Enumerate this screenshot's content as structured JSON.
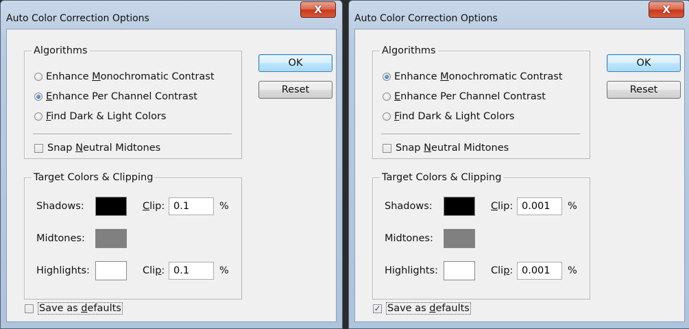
{
  "dialogs": [
    {
      "title": "Auto Color Correction Options",
      "algorithms_legend": "Algorithms",
      "algorithms": [
        {
          "pre": "Enhance ",
          "u": "M",
          "post": "onochromatic Contrast",
          "selected": false
        },
        {
          "pre": "",
          "u": "E",
          "post": "nhance Per Channel Contrast",
          "selected": true
        },
        {
          "pre": "",
          "u": "F",
          "post": "ind Dark & Light Colors",
          "selected": false
        }
      ],
      "snap": {
        "pre": "Snap ",
        "u": "N",
        "post": "eutral Midtones",
        "checked": false
      },
      "ok_label": "OK",
      "reset_label": "Reset",
      "target_legend": "Target Colors & Clipping",
      "shadows_label": "Shadows:",
      "midtones_label": "Midtones:",
      "highlights_label": "Highlights:",
      "clip1": {
        "u": "C",
        "post": "lip:"
      },
      "clip2": {
        "pre": "Cli",
        "u": "p",
        "post": ":"
      },
      "shadows_clip": "0.1",
      "highlights_clip": "0.1",
      "percent": "%",
      "shadows_color": "#000000",
      "midtones_color": "#808080",
      "highlights_color": "#ffffff",
      "save_defaults": {
        "pre": "Save as ",
        "u": "d",
        "post": "efaults",
        "checked": false
      }
    },
    {
      "title": "Auto Color Correction Options",
      "algorithms_legend": "Algorithms",
      "algorithms": [
        {
          "pre": "Enhance ",
          "u": "M",
          "post": "onochromatic Contrast",
          "selected": true
        },
        {
          "pre": "",
          "u": "E",
          "post": "nhance Per Channel Contrast",
          "selected": false
        },
        {
          "pre": "",
          "u": "F",
          "post": "ind Dark & Light Colors",
          "selected": false
        }
      ],
      "snap": {
        "pre": "Snap ",
        "u": "N",
        "post": "eutral Midtones",
        "checked": false
      },
      "ok_label": "OK",
      "reset_label": "Reset",
      "target_legend": "Target Colors & Clipping",
      "shadows_label": "Shadows:",
      "midtones_label": "Midtones:",
      "highlights_label": "Highlights:",
      "clip1": {
        "u": "C",
        "post": "lip:"
      },
      "clip2": {
        "pre": "Cli",
        "u": "p",
        "post": ":"
      },
      "shadows_clip": "0.001",
      "highlights_clip": "0.001",
      "percent": "%",
      "shadows_color": "#000000",
      "midtones_color": "#808080",
      "highlights_color": "#ffffff",
      "save_defaults": {
        "pre": "Save as ",
        "u": "d",
        "post": "efaults",
        "checked": true
      }
    }
  ],
  "icons": {
    "close": "close-x-icon",
    "radio": "radio-icon",
    "checkbox": "checkbox-icon"
  },
  "close_glyph": "X",
  "check_glyph": "✓"
}
